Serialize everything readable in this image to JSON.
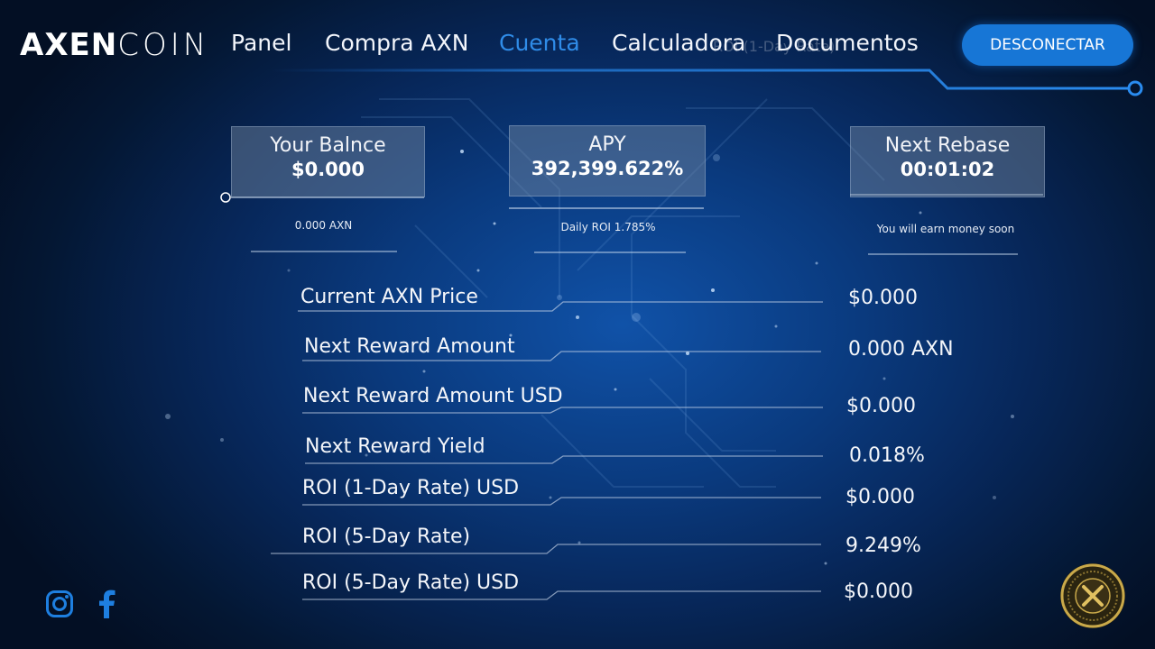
{
  "logo": {
    "part1": "AXEN",
    "part2": "COIN"
  },
  "nav": {
    "items": [
      {
        "label": "Panel"
      },
      {
        "label": "Compra AXN"
      },
      {
        "label": "Cuenta"
      },
      {
        "label": "Calculadora"
      },
      {
        "label": "Documentos"
      }
    ],
    "active_index": 2
  },
  "ghost_text": "ROI (1-Day Rate)",
  "disconnect_label": "DESCONECTAR",
  "stats": {
    "balance": {
      "label": "Your Balnce",
      "value": "$0.000",
      "sub": "0.000 AXN"
    },
    "apy": {
      "label": "APY",
      "value": "392,399.622%",
      "sub": "Daily ROI 1.785%"
    },
    "rebase": {
      "label": "Next Rebase",
      "value": "00:01:02",
      "sub": "You will earn money soon"
    }
  },
  "rows": [
    {
      "label": "Current AXN Price",
      "value": "$0.000"
    },
    {
      "label": "Next Reward Amount",
      "value": "0.000 AXN"
    },
    {
      "label": "Next Reward Amount USD",
      "value": "$0.000"
    },
    {
      "label": "Next Reward Yield",
      "value": "0.018%"
    },
    {
      "label": "ROI (1-Day Rate) USD",
      "value": "$0.000"
    },
    {
      "label": "ROI (5-Day Rate)",
      "value": "9.249%"
    },
    {
      "label": "ROI (5-Day Rate) USD",
      "value": "$0.000"
    }
  ],
  "social": {
    "instagram_icon": "instagram-icon",
    "facebook_icon": "facebook-icon"
  },
  "colors": {
    "accent": "#1776d6",
    "active_nav": "#2f8ce8",
    "background": "#07275a",
    "coin_gold": "#c9a94a"
  }
}
